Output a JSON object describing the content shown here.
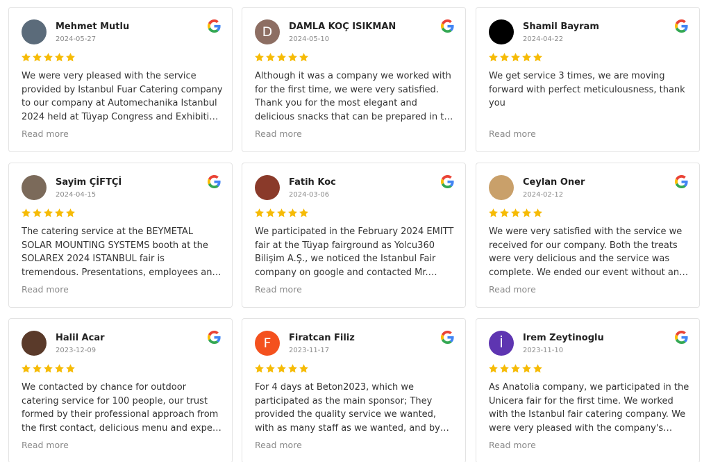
{
  "read_more_label": "Read more",
  "colors": {
    "star": "#f6bb06",
    "google_blue": "#4285F4",
    "google_red": "#EA4335",
    "google_yellow": "#FBBC05",
    "google_green": "#34A853"
  },
  "reviews": [
    {
      "name": "Mehmet Mutlu",
      "date": "2024-05-27",
      "rating": 5,
      "avatar": {
        "type": "photo",
        "letter": "",
        "color": "#5b6b7a"
      },
      "text": "We were very pleased with the service provided by Istanbul Fuar Catering company to our company at Automechanika Istanbul 2024 held at Tüyap Congress and Exhibition Center..."
    },
    {
      "name": "DAMLA KOÇ ISIKMAN",
      "date": "2024-05-10",
      "rating": 5,
      "avatar": {
        "type": "letter",
        "letter": "D",
        "color": "#8d6e63"
      },
      "text": "Although it was a company we worked with for the first time, we were very satisfied. Thank you for the most elegant and delicious snacks that can be prepared in the fair environment..."
    },
    {
      "name": "Shamil Bayram",
      "date": "2024-04-22",
      "rating": 5,
      "avatar": {
        "type": "letter",
        "letter": "",
        "color": "#000000"
      },
      "text": "We get service 3 times, we are moving forward with perfect meticulousness, thank you"
    },
    {
      "name": "Sayim ÇİFTÇİ",
      "date": "2024-04-15",
      "rating": 5,
      "avatar": {
        "type": "photo",
        "letter": "",
        "color": "#7b6a5a"
      },
      "text": "The catering service at the BEYMETAL SOLAR MOUNTING SYSTEMS booth at the SOLAREX 2024 ISTANBUL fair is tremendous. Presentations, employees and package products..."
    },
    {
      "name": "Fatih Koc",
      "date": "2024-03-06",
      "rating": 5,
      "avatar": {
        "type": "photo",
        "letter": "",
        "color": "#8a3a2a"
      },
      "text": "We participated in the February 2024 EMITT fair at the Tüyap fairground as Yolcu360 Bilişim A.Ş., we noticed the Istanbul Fair company on google and contacted Mr. Kaan..."
    },
    {
      "name": "Ceylan Oner",
      "date": "2024-02-12",
      "rating": 5,
      "avatar": {
        "type": "photo",
        "letter": "",
        "color": "#c9a06a"
      },
      "text": "We were very satisfied with the service we received for our company. Both the treats were very delicious and the service was complete. We ended our event without any problems..."
    },
    {
      "name": "Halil Acar",
      "date": "2023-12-09",
      "rating": 5,
      "avatar": {
        "type": "photo",
        "letter": "",
        "color": "#5a3a2a"
      },
      "text": "We contacted by chance for outdoor catering service for 100 people, our trust formed by their professional approach from the first contact, delicious menu and expert staff..."
    },
    {
      "name": "Firatcan Filiz",
      "date": "2023-11-17",
      "rating": 5,
      "avatar": {
        "type": "letter",
        "letter": "F",
        "color": "#f4511e"
      },
      "text": "For 4 days at Beton2023, which we participated as the main sponsor; They provided the quality service we wanted, with as many staff as we wanted, and by solving every problem..."
    },
    {
      "name": "Irem Zeytinoglu",
      "date": "2023-11-10",
      "rating": 5,
      "avatar": {
        "type": "letter",
        "letter": "İ",
        "color": "#5e35b1"
      },
      "text": "As Anatolia company, we participated in the Unicera fair for the first time. We worked with the Istanbul fair catering company. We were very pleased with the company's service..."
    }
  ]
}
